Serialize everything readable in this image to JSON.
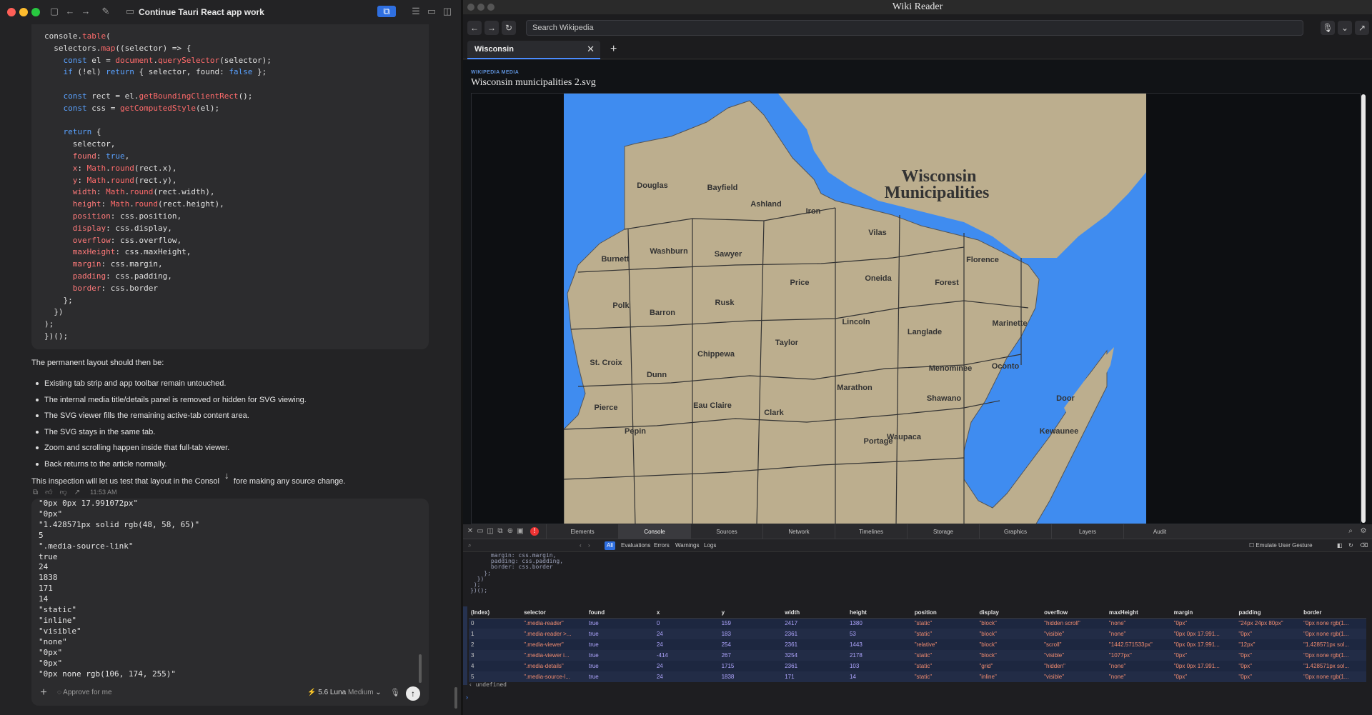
{
  "left": {
    "chat_title": "Continue Tauri React app work",
    "code_lines": [
      "console.table(",
      "  selectors.map((selector) => {",
      "    const el = document.querySelector(selector);",
      "    if (!el) return { selector, found: false };",
      "",
      "    const rect = el.getBoundingClientRect();",
      "    const css = getComputedStyle(el);",
      "",
      "    return {",
      "      selector,",
      "      found: true,",
      "      x: Math.round(rect.x),",
      "      y: Math.round(rect.y),",
      "      width: Math.round(rect.width),",
      "      height: Math.round(rect.height),",
      "      position: css.position,",
      "      display: css.display,",
      "      overflow: css.overflow,",
      "      maxHeight: css.maxHeight,",
      "      margin: css.margin,",
      "      padding: css.padding,",
      "      border: css.border",
      "    };",
      "  })",
      ");",
      "})();"
    ],
    "prose_intro": "The permanent layout should then be:",
    "bullets": [
      "Existing tab strip and app toolbar remain untouched.",
      "The internal media title/details panel is removed or hidden for SVG viewing.",
      "The SVG viewer fills the remaining active-tab content area.",
      "The SVG stays in the same tab.",
      "Zoom and scrolling happen inside that full-tab viewer.",
      "Back returns to the article normally."
    ],
    "prose_outro_a": "This inspection will let us test that layout in the Consol",
    "prose_outro_b": "fore making any source change.",
    "message_time": "11:53 AM",
    "composer_lines": [
      "\"0px 0px 17.991072px\"",
      "\"0px\"",
      "\"1.428571px solid rgb(48, 58, 65)\"",
      "5",
      "\".media-source-link\"",
      "true",
      "24",
      "1838",
      "171",
      "14",
      "\"static\"",
      "\"inline\"",
      "\"visible\"",
      "\"none\"",
      "\"0px\"",
      "\"0px\"",
      "\"0px none rgb(106, 174, 255)\""
    ],
    "approve_label": "Approve for me",
    "model_label": "5.6 Luna",
    "effort_label": "Medium"
  },
  "right": {
    "window_title": "Wiki Reader",
    "search_placeholder": "Search Wikipedia",
    "tab_label": "Wisconsin",
    "media_kicker": "WIKIPEDIA MEDIA",
    "media_title": "Wisconsin municipalities 2.svg",
    "map": {
      "title_line1": "Wisconsin",
      "title_line2": "Municipalities",
      "counties": [
        {
          "name": "Douglas"
        },
        {
          "name": "Bayfield"
        },
        {
          "name": "Ashland"
        },
        {
          "name": "Iron"
        },
        {
          "name": "Vilas"
        },
        {
          "name": "Burnett"
        },
        {
          "name": "Washburn"
        },
        {
          "name": "Sawyer"
        },
        {
          "name": "Florence"
        },
        {
          "name": "Oneida"
        },
        {
          "name": "Price"
        },
        {
          "name": "Forest"
        },
        {
          "name": "Polk"
        },
        {
          "name": "Barron"
        },
        {
          "name": "Rusk"
        },
        {
          "name": "Lincoln"
        },
        {
          "name": "Langlade"
        },
        {
          "name": "Marinette"
        },
        {
          "name": "Taylor"
        },
        {
          "name": "St. Croix"
        },
        {
          "name": "Chippewa"
        },
        {
          "name": "Dunn"
        },
        {
          "name": "Menominee"
        },
        {
          "name": "Oconto"
        },
        {
          "name": "Marathon"
        },
        {
          "name": "Eau Claire"
        },
        {
          "name": "Shawano"
        },
        {
          "name": "Pierce"
        },
        {
          "name": "Clark"
        },
        {
          "name": "Door"
        },
        {
          "name": "Pepin"
        },
        {
          "name": "Waupaca"
        },
        {
          "name": "Kewaunee"
        },
        {
          "name": "Portage"
        }
      ]
    },
    "devtools": {
      "tabs": [
        "Elements",
        "Console",
        "Sources",
        "Network",
        "Timelines",
        "Storage",
        "Graphics",
        "Layers",
        "Audit"
      ],
      "active_tab": "Console",
      "filters": [
        "All",
        "Evaluations",
        "Errors",
        "Warnings",
        "Logs"
      ],
      "emulate_label": "Emulate User Gesture",
      "console_code": [
        "      margin: css.margin,",
        "      padding: css.padding,",
        "      border: css.border",
        "    };",
        "  })",
        " );",
        "})();"
      ],
      "columns": [
        "(Index)",
        "selector",
        "found",
        "x",
        "y",
        "width",
        "height",
        "position",
        "display",
        "overflow",
        "maxHeight",
        "margin",
        "padding",
        "border"
      ],
      "rows": [
        [
          "0",
          "\".media-reader\"",
          "true",
          "0",
          "159",
          "2417",
          "1380",
          "\"static\"",
          "\"block\"",
          "\"hidden scroll\"",
          "\"none\"",
          "\"0px\"",
          "\"24px 24px 80px\"",
          "\"0px none rgb(1..."
        ],
        [
          "1",
          "\".media-reader >...",
          "true",
          "24",
          "183",
          "2361",
          "53",
          "\"static\"",
          "\"block\"",
          "\"visible\"",
          "\"none\"",
          "\"0px 0px 17.991...",
          "\"0px\"",
          "\"0px none rgb(1..."
        ],
        [
          "2",
          "\".media-viewer\"",
          "true",
          "24",
          "254",
          "2361",
          "1443",
          "\"relative\"",
          "\"block\"",
          "\"scroll\"",
          "\"1442.571533px\"",
          "\"0px 0px 17.991...",
          "\"12px\"",
          "\"1.428571px sol..."
        ],
        [
          "3",
          "\".media-viewer i...",
          "true",
          "-414",
          "267",
          "3254",
          "2178",
          "\"static\"",
          "\"block\"",
          "\"visible\"",
          "\"1077px\"",
          "\"0px\"",
          "\"0px\"",
          "\"0px none rgb(1..."
        ],
        [
          "4",
          "\".media-details\"",
          "true",
          "24",
          "1715",
          "2361",
          "103",
          "\"static\"",
          "\"grid\"",
          "\"hidden\"",
          "\"none\"",
          "\"0px 0px 17.991...",
          "\"0px\"",
          "\"1.428571px sol..."
        ],
        [
          "5",
          "\".media-source-l...",
          "true",
          "24",
          "1838",
          "171",
          "14",
          "\"static\"",
          "\"inline\"",
          "\"visible\"",
          "\"none\"",
          "\"0px\"",
          "\"0px\"",
          "\"0px none rgb(1..."
        ]
      ],
      "result": "undefined"
    }
  },
  "colors": {
    "map_water": "#3f8cf0",
    "map_land": "#bcae8e",
    "map_region_bg": "#d8cca8",
    "accent": "#4a8cff"
  }
}
